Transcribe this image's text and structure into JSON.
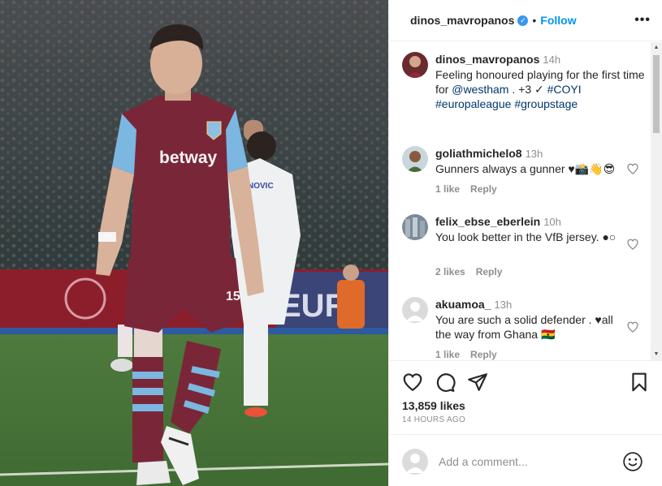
{
  "post": {
    "author": "dinos_mavropanos",
    "verified_icon": "verified-badge-icon",
    "separator": "•",
    "follow_label": "Follow",
    "more_label": "•••",
    "caption": {
      "author": "dinos_mavropanos",
      "time": "14h",
      "text_1": "Feeling honoured playing for the first time for",
      "mention": "@westham",
      "text_2": ". +3 ✓",
      "tag_1": "#COYI",
      "tag_2": "#europaleague",
      "tag_3": "#groupstage"
    },
    "jersey_text": "betway",
    "shirt_number": "15",
    "opponent_name": "NOVIC",
    "board_text": "EUR"
  },
  "comments": [
    {
      "user": "goliathmichelo8",
      "time": "13h",
      "text": "Gunners always a gunner ♥📸👋😎",
      "likes": "1 like",
      "reply": "Reply"
    },
    {
      "user": "felix_ebse_eberlein",
      "time": "10h",
      "text": "You look better in the VfB jersey. ●○",
      "likes": "2 likes",
      "reply": "Reply"
    },
    {
      "user": "akuamoa_",
      "time": "13h",
      "text": "You are such a solid defender . ♥all the way from Ghana 🇬🇭",
      "likes": "1 like",
      "reply": "Reply"
    }
  ],
  "stats": {
    "likes": "13,859 likes",
    "time_ago": "14 HOURS AGO"
  },
  "add_comment": {
    "placeholder": "Add a comment..."
  },
  "scroll": {
    "up": "▲",
    "down": "▼"
  },
  "colors": {
    "accent": "#0095f6",
    "claret": "#7a2639",
    "sky": "#7bb7e0"
  }
}
